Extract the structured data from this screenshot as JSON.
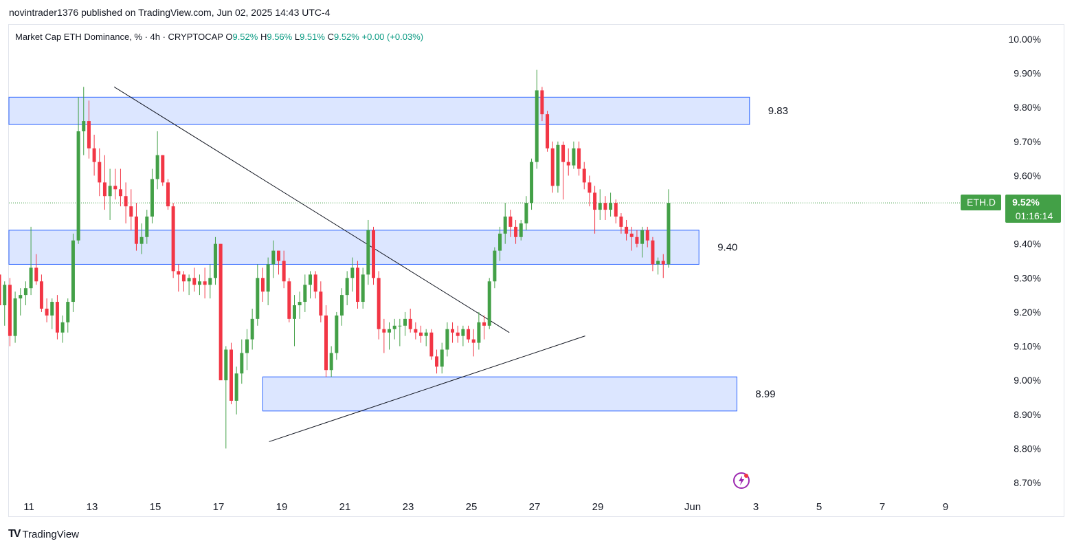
{
  "header": {
    "published_line": "novintrader1376 published on TradingView.com, Jun 02, 2025 14:43 UTC-4"
  },
  "legend": {
    "title": "Market Cap ETH Dominance, % · 4h · CRYPTOCAP",
    "o_label": "O",
    "o_value": "9.52%",
    "h_label": "H",
    "h_value": "9.56%",
    "l_label": "L",
    "l_value": "9.51%",
    "c_label": "C",
    "c_value": "9.52%",
    "change": "+0.00 (+0.03%)"
  },
  "price_tag": {
    "symbol": "ETH.D",
    "price": "9.52%",
    "countdown": "01:16:14"
  },
  "footer": {
    "brand": "TradingView"
  },
  "colors": {
    "up": "#43a047",
    "down": "#f23645",
    "zone_fill": "#d6e2ff",
    "zone_stroke": "#2962ff",
    "tag_bg": "#43a047"
  },
  "chart_data": {
    "type": "candlestick",
    "symbol": "ETH.D",
    "interval": "4h",
    "ylim": [
      8.65,
      10.05
    ],
    "y_ticks": [
      "10.00%",
      "9.90%",
      "9.80%",
      "9.70%",
      "9.60%",
      "9.50%",
      "9.40%",
      "9.30%",
      "9.20%",
      "9.10%",
      "9.00%",
      "8.90%",
      "8.80%",
      "8.70%"
    ],
    "y_tick_values": [
      10.0,
      9.9,
      9.8,
      9.7,
      9.6,
      9.5,
      9.4,
      9.3,
      9.2,
      9.1,
      9.0,
      8.9,
      8.8,
      8.7
    ],
    "x_ticks": [
      "11",
      "13",
      "15",
      "17",
      "19",
      "21",
      "23",
      "25",
      "27",
      "29",
      "Jun",
      "3",
      "5",
      "7",
      "9"
    ],
    "x_tick_days": [
      11,
      13,
      15,
      17,
      19,
      21,
      23,
      25,
      27,
      29,
      32,
      34,
      36,
      38,
      40
    ],
    "zones": [
      {
        "label": "9.83",
        "low": 9.75,
        "high": 9.83,
        "from_day": 9.4,
        "to_day": 33.8
      },
      {
        "label": "9.40",
        "low": 9.34,
        "high": 9.44,
        "from_day": 9.4,
        "to_day": 32.2
      },
      {
        "label": "8.99",
        "low": 8.91,
        "high": 9.01,
        "from_day": 18.4,
        "to_day": 33.4
      }
    ],
    "trendlines": [
      {
        "from": [
          13.7,
          9.86
        ],
        "to": [
          26.2,
          9.14
        ]
      },
      {
        "from": [
          18.6,
          8.82
        ],
        "to": [
          28.6,
          9.13
        ]
      }
    ],
    "last_price": 9.52,
    "candles_start_day": 9.4,
    "candle_step_days": 0.1667,
    "candles": [
      [
        9.08,
        9.28,
        9.08,
        9.27
      ],
      [
        9.27,
        9.34,
        9.21,
        9.32
      ],
      [
        9.32,
        9.42,
        9.26,
        9.39
      ],
      [
        9.39,
        9.42,
        9.28,
        9.31
      ],
      [
        9.31,
        9.34,
        9.2,
        9.22
      ],
      [
        9.22,
        9.29,
        9.16,
        9.28
      ],
      [
        9.28,
        9.3,
        9.1,
        9.13
      ],
      [
        9.13,
        9.26,
        9.11,
        9.24
      ],
      [
        9.24,
        9.27,
        9.19,
        9.25
      ],
      [
        9.25,
        9.29,
        9.22,
        9.27
      ],
      [
        9.27,
        9.45,
        9.25,
        9.33
      ],
      [
        9.33,
        9.37,
        9.28,
        9.29
      ],
      [
        9.29,
        9.31,
        9.2,
        9.21
      ],
      [
        9.21,
        9.24,
        9.17,
        9.19
      ],
      [
        9.19,
        9.24,
        9.15,
        9.23
      ],
      [
        9.23,
        9.25,
        9.12,
        9.14
      ],
      [
        9.14,
        9.19,
        9.11,
        9.17
      ],
      [
        9.17,
        9.24,
        9.14,
        9.23
      ],
      [
        9.23,
        9.43,
        9.2,
        9.41
      ],
      [
        9.41,
        9.83,
        9.4,
        9.73
      ],
      [
        9.73,
        9.86,
        9.66,
        9.76
      ],
      [
        9.76,
        9.82,
        9.65,
        9.68
      ],
      [
        9.68,
        9.72,
        9.6,
        9.64
      ],
      [
        9.64,
        9.68,
        9.54,
        9.58
      ],
      [
        9.58,
        9.66,
        9.5,
        9.54
      ],
      [
        9.54,
        9.62,
        9.47,
        9.57
      ],
      [
        9.57,
        9.62,
        9.53,
        9.56
      ],
      [
        9.56,
        9.62,
        9.51,
        9.54
      ],
      [
        9.54,
        9.58,
        9.46,
        9.51
      ],
      [
        9.51,
        9.56,
        9.44,
        9.48
      ],
      [
        9.48,
        9.52,
        9.38,
        9.4
      ],
      [
        9.4,
        9.46,
        9.37,
        9.42
      ],
      [
        9.42,
        9.5,
        9.4,
        9.48
      ],
      [
        9.48,
        9.62,
        9.46,
        9.59
      ],
      [
        9.59,
        9.73,
        9.56,
        9.66
      ],
      [
        9.66,
        9.66,
        9.57,
        9.58
      ],
      [
        9.58,
        9.59,
        9.5,
        9.51
      ],
      [
        9.51,
        9.52,
        9.3,
        9.32
      ],
      [
        9.32,
        9.34,
        9.26,
        9.31
      ],
      [
        9.31,
        9.32,
        9.26,
        9.29
      ],
      [
        9.29,
        9.31,
        9.25,
        9.3
      ],
      [
        9.3,
        9.33,
        9.26,
        9.28
      ],
      [
        9.28,
        9.31,
        9.25,
        9.29
      ],
      [
        9.29,
        9.33,
        9.24,
        9.28
      ],
      [
        9.28,
        9.34,
        9.24,
        9.3
      ],
      [
        9.3,
        9.42,
        9.28,
        9.4
      ],
      [
        9.4,
        9.4,
        9.04,
        9.0
      ],
      [
        9.0,
        9.1,
        8.8,
        9.09
      ],
      [
        9.09,
        9.11,
        8.93,
        8.94
      ],
      [
        8.94,
        9.04,
        8.9,
        9.02
      ],
      [
        9.02,
        9.12,
        8.99,
        9.08
      ],
      [
        9.08,
        9.15,
        9.03,
        9.12
      ],
      [
        9.12,
        9.21,
        9.09,
        9.18
      ],
      [
        9.18,
        9.34,
        9.16,
        9.3
      ],
      [
        9.3,
        9.33,
        9.23,
        9.26
      ],
      [
        9.26,
        9.36,
        9.22,
        9.34
      ],
      [
        9.34,
        9.41,
        9.3,
        9.38
      ],
      [
        9.38,
        9.38,
        9.31,
        9.35
      ],
      [
        9.35,
        9.38,
        9.27,
        9.29
      ],
      [
        9.29,
        9.3,
        9.17,
        9.18
      ],
      [
        9.18,
        9.25,
        9.1,
        9.22
      ],
      [
        9.22,
        9.26,
        9.18,
        9.23
      ],
      [
        9.23,
        9.31,
        9.2,
        9.28
      ],
      [
        9.28,
        9.32,
        9.24,
        9.31
      ],
      [
        9.31,
        9.32,
        9.24,
        9.26
      ],
      [
        9.26,
        9.29,
        9.17,
        9.19
      ],
      [
        9.19,
        9.22,
        9.01,
        9.03
      ],
      [
        9.03,
        9.1,
        9.01,
        9.08
      ],
      [
        9.08,
        9.2,
        9.06,
        9.19
      ],
      [
        9.19,
        9.27,
        9.16,
        9.25
      ],
      [
        9.25,
        9.32,
        9.22,
        9.3
      ],
      [
        9.3,
        9.36,
        9.26,
        9.33
      ],
      [
        9.33,
        9.35,
        9.21,
        9.23
      ],
      [
        9.23,
        9.33,
        9.21,
        9.31
      ],
      [
        9.31,
        9.47,
        9.28,
        9.44
      ],
      [
        9.44,
        9.45,
        9.28,
        9.3
      ],
      [
        9.3,
        9.32,
        9.12,
        9.15
      ],
      [
        9.15,
        9.18,
        9.08,
        9.14
      ],
      [
        9.14,
        9.17,
        9.09,
        9.15
      ],
      [
        9.15,
        9.18,
        9.12,
        9.16
      ],
      [
        9.16,
        9.18,
        9.1,
        9.16
      ],
      [
        9.16,
        9.2,
        9.13,
        9.18
      ],
      [
        9.18,
        9.21,
        9.14,
        9.15
      ],
      [
        9.15,
        9.17,
        9.12,
        9.14
      ],
      [
        9.14,
        9.16,
        9.11,
        9.13
      ],
      [
        9.13,
        9.15,
        9.1,
        9.14
      ],
      [
        9.14,
        9.15,
        9.06,
        9.07
      ],
      [
        9.07,
        9.09,
        9.02,
        9.04
      ],
      [
        9.04,
        9.11,
        9.02,
        9.09
      ],
      [
        9.09,
        9.17,
        9.07,
        9.15
      ],
      [
        9.15,
        9.17,
        9.11,
        9.14
      ],
      [
        9.14,
        9.16,
        9.11,
        9.13
      ],
      [
        9.13,
        9.16,
        9.1,
        9.15
      ],
      [
        9.15,
        9.16,
        9.11,
        9.12
      ],
      [
        9.12,
        9.15,
        9.07,
        9.11
      ],
      [
        9.11,
        9.2,
        9.09,
        9.17
      ],
      [
        9.17,
        9.19,
        9.12,
        9.16
      ],
      [
        9.16,
        9.3,
        9.15,
        9.29
      ],
      [
        9.29,
        9.39,
        9.27,
        9.38
      ],
      [
        9.38,
        9.45,
        9.35,
        9.43
      ],
      [
        9.43,
        9.52,
        9.4,
        9.48
      ],
      [
        9.48,
        9.5,
        9.42,
        9.45
      ],
      [
        9.45,
        9.47,
        9.4,
        9.42
      ],
      [
        9.42,
        9.47,
        9.41,
        9.46
      ],
      [
        9.46,
        9.54,
        9.44,
        9.52
      ],
      [
        9.52,
        9.65,
        9.5,
        9.64
      ],
      [
        9.64,
        9.91,
        9.62,
        9.85
      ],
      [
        9.85,
        9.86,
        9.76,
        9.78
      ],
      [
        9.78,
        9.79,
        9.67,
        9.68
      ],
      [
        9.68,
        9.7,
        9.55,
        9.57
      ],
      [
        9.57,
        9.7,
        9.55,
        9.69
      ],
      [
        9.69,
        9.7,
        9.53,
        9.64
      ],
      [
        9.64,
        9.68,
        9.6,
        9.63
      ],
      [
        9.63,
        9.7,
        9.62,
        9.68
      ],
      [
        9.68,
        9.7,
        9.6,
        9.62
      ],
      [
        9.62,
        9.64,
        9.56,
        9.58
      ],
      [
        9.58,
        9.6,
        9.51,
        9.55
      ],
      [
        9.55,
        9.57,
        9.43,
        9.5
      ],
      [
        9.5,
        9.56,
        9.47,
        9.52
      ],
      [
        9.52,
        9.54,
        9.47,
        9.5
      ],
      [
        9.5,
        9.55,
        9.48,
        9.52
      ],
      [
        9.52,
        9.53,
        9.46,
        9.48
      ],
      [
        9.48,
        9.49,
        9.43,
        9.45
      ],
      [
        9.45,
        9.47,
        9.41,
        9.43
      ],
      [
        9.43,
        9.45,
        9.38,
        9.42
      ],
      [
        9.42,
        9.44,
        9.39,
        9.4
      ],
      [
        9.4,
        9.45,
        9.36,
        9.44
      ],
      [
        9.44,
        9.45,
        9.39,
        9.41
      ],
      [
        9.41,
        9.42,
        9.32,
        9.34
      ],
      [
        9.34,
        9.36,
        9.31,
        9.35
      ],
      [
        9.35,
        9.37,
        9.3,
        9.34
      ],
      [
        9.34,
        9.56,
        9.33,
        9.52
      ]
    ]
  }
}
